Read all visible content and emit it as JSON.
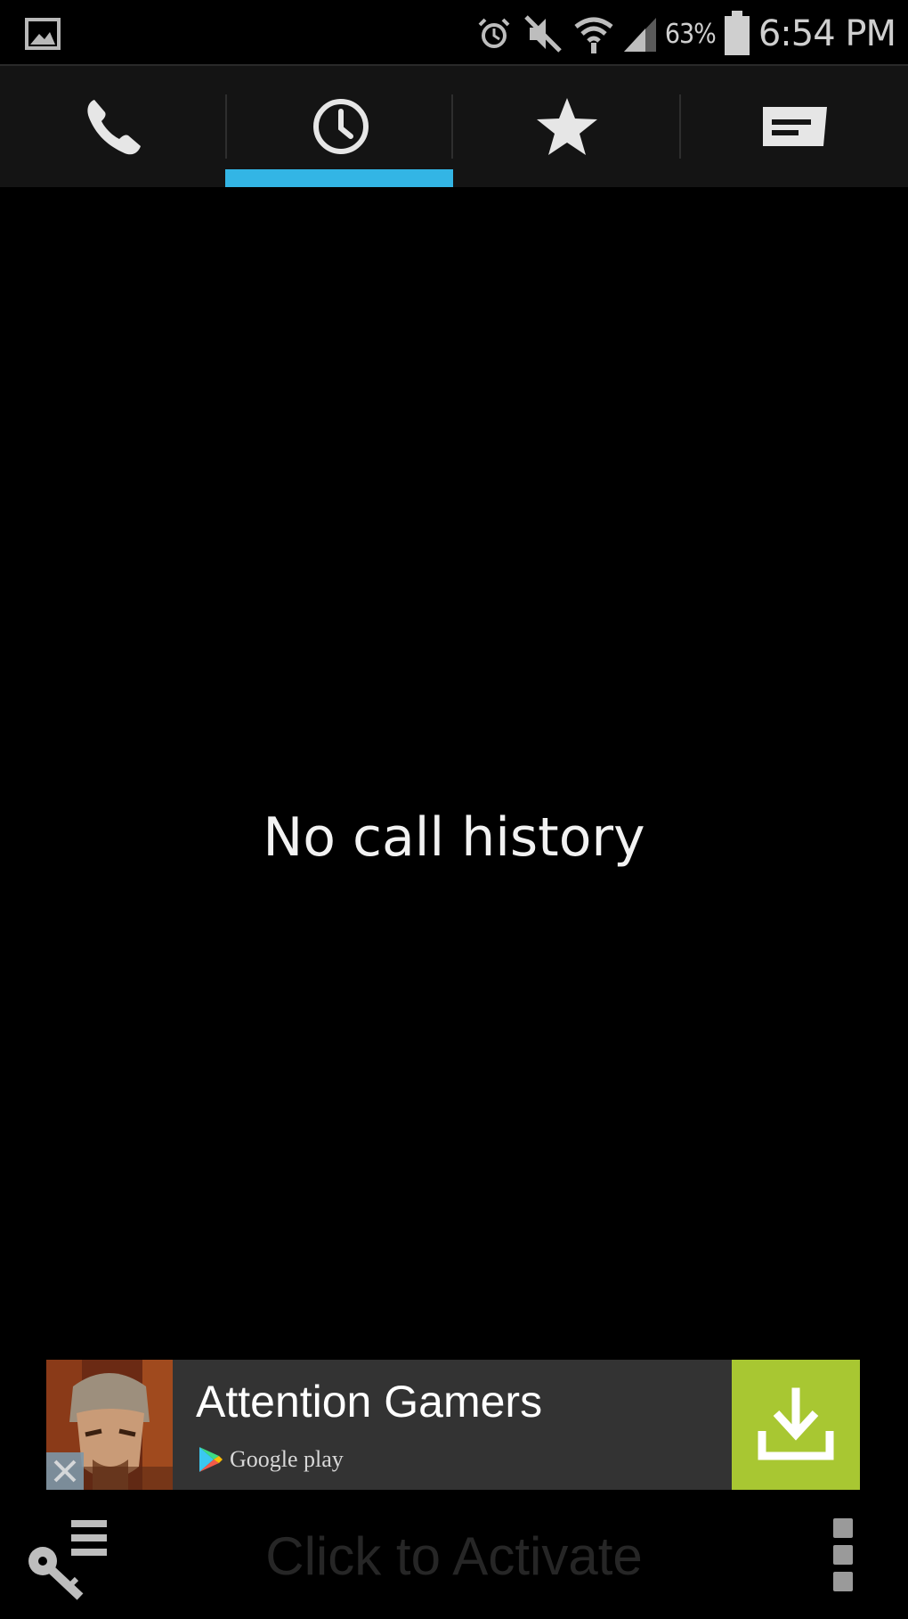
{
  "status_bar": {
    "battery_percent": "63%",
    "time": "6:54 PM",
    "icons": [
      "gallery-icon",
      "alarm-icon",
      "mute-icon",
      "wifi-icon",
      "signal-icon",
      "battery-icon"
    ]
  },
  "tabs": [
    {
      "name": "phone",
      "icon": "phone-icon",
      "selected": false
    },
    {
      "name": "logs",
      "icon": "clock-icon",
      "selected": true
    },
    {
      "name": "favorites",
      "icon": "star-icon",
      "selected": false
    },
    {
      "name": "messages",
      "icon": "message-icon",
      "selected": false
    }
  ],
  "main": {
    "empty_message": "No call history"
  },
  "ad": {
    "title": "Attention Gamers",
    "store_label": "Google play",
    "download_icon": "download-icon"
  },
  "bottom_bar": {
    "activate_label": "Click to Activate",
    "icons": [
      "key-list-icon",
      "overflow-menu-icon"
    ]
  },
  "colors": {
    "accent": "#33b5e5",
    "tab_bar_bg": "#141414",
    "ad_bg": "#333333",
    "download_bg": "#a8c732",
    "background": "#000000"
  }
}
